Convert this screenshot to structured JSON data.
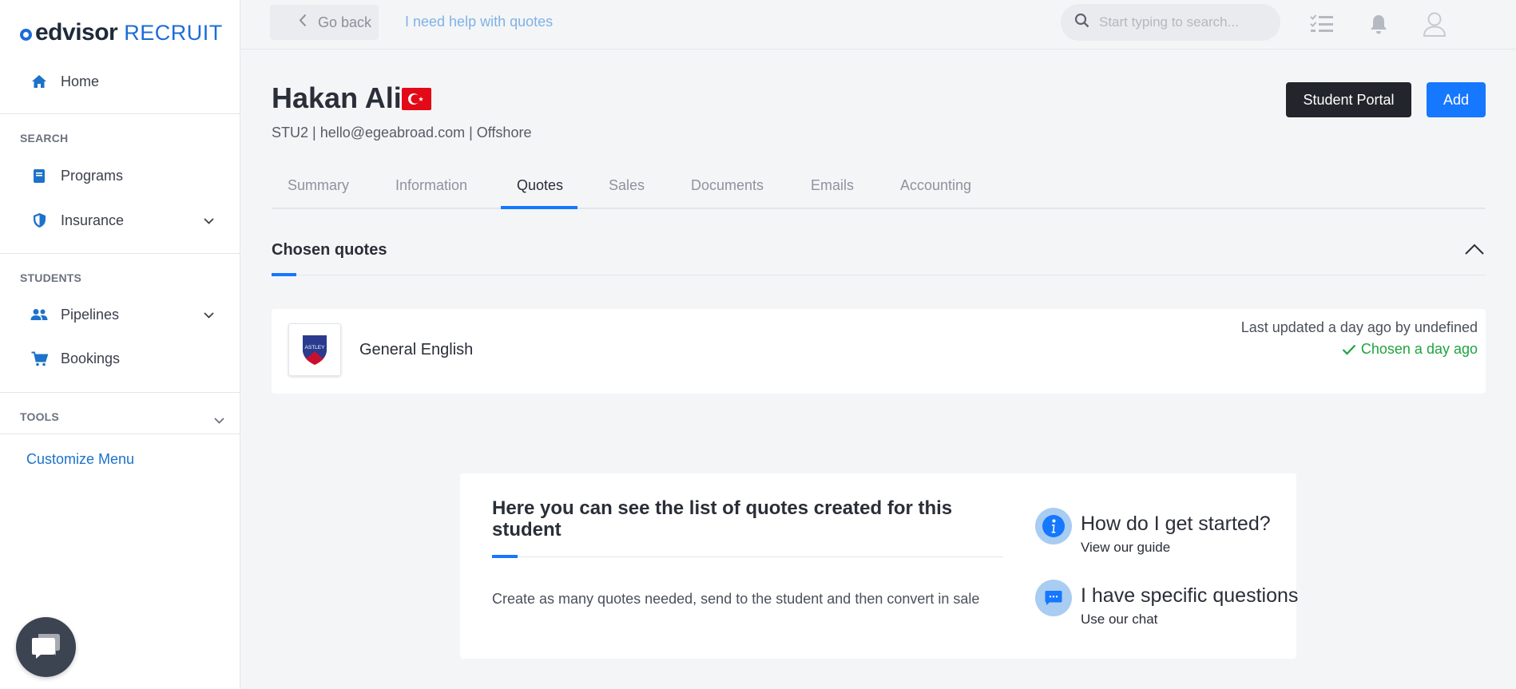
{
  "brand": {
    "main": "edvisor",
    "sub": "RECRUIT"
  },
  "sidebar": {
    "home_label": "Home",
    "search_section": "SEARCH",
    "programs_label": "Programs",
    "insurance_label": "Insurance",
    "students_section": "STUDENTS",
    "pipelines_label": "Pipelines",
    "bookings_label": "Bookings",
    "tools_section": "TOOLS",
    "customize_label": "Customize Menu"
  },
  "topbar": {
    "go_back_label": "Go back",
    "help_link": "I need help with quotes",
    "search_placeholder": "Start typing to search..."
  },
  "student": {
    "name": "Hakan Ali",
    "flag": "turkey-flag",
    "meta": "STU2 | hello@egeabroad.com | Offshore",
    "portal_button": "Student Portal",
    "add_button": "Add"
  },
  "tabs": {
    "summary": "Summary",
    "information": "Information",
    "quotes": "Quotes",
    "sales": "Sales",
    "documents": "Documents",
    "emails": "Emails",
    "accounting": "Accounting",
    "active": "Quotes"
  },
  "chosen_quotes": {
    "title": "Chosen quotes",
    "quote": {
      "school_logo_text": "ASTLEY",
      "name": "General English",
      "updated": "Last updated a day ago by undefined",
      "chosen": "Chosen a day ago"
    }
  },
  "info": {
    "title": "Here you can see the list of quotes created for this student",
    "description": "Create as many quotes needed, send to the student and then convert in sale",
    "get_started_title": "How do I get started?",
    "get_started_sub": "View our guide",
    "questions_title": "I have specific questions",
    "questions_sub": "Use our chat"
  },
  "colors": {
    "accent": "#1677ff",
    "success": "#1fa33f",
    "dark_button": "#22252b"
  }
}
